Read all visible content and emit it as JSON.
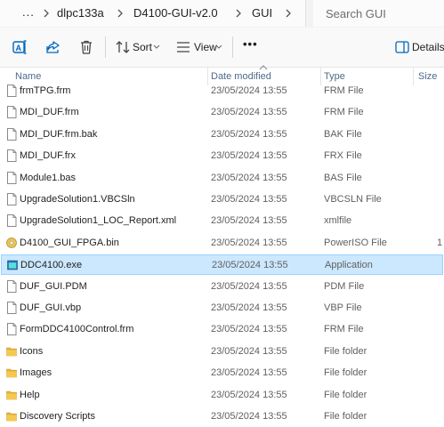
{
  "address_bar": {
    "overflow": "...",
    "crumbs": [
      "dlpc133a",
      "D4100-GUI-v2.0",
      "GUI"
    ],
    "search_placeholder": "Search GUI"
  },
  "toolbar": {
    "sort_label": "Sort",
    "view_label": "View",
    "more_label": "•••",
    "details_label": "Details"
  },
  "columns": {
    "name": "Name",
    "date": "Date modified",
    "type": "Type",
    "size": "Size"
  },
  "files": [
    {
      "name": "frmTPG.frm",
      "date": "23/05/2024 13:55",
      "type": "FRM File",
      "icon": "file-icon"
    },
    {
      "name": "MDI_DUF.frm",
      "date": "23/05/2024 13:55",
      "type": "FRM File",
      "icon": "file-icon"
    },
    {
      "name": "MDI_DUF.frm.bak",
      "date": "23/05/2024 13:55",
      "type": "BAK File",
      "icon": "file-icon"
    },
    {
      "name": "MDI_DUF.frx",
      "date": "23/05/2024 13:55",
      "type": "FRX File",
      "icon": "file-icon"
    },
    {
      "name": "Module1.bas",
      "date": "23/05/2024 13:55",
      "type": "BAS File",
      "icon": "file-icon"
    },
    {
      "name": "UpgradeSolution1.VBCSln",
      "date": "23/05/2024 13:55",
      "type": "VBCSLN File",
      "icon": "file-icon"
    },
    {
      "name": "UpgradeSolution1_LOC_Report.xml",
      "date": "23/05/2024 13:55",
      "type": "xmlfile",
      "icon": "file-icon"
    },
    {
      "name": "D4100_GUI_FPGA.bin",
      "date": "23/05/2024 13:55",
      "type": "PowerISO File",
      "size": "1",
      "icon": "disc-image-icon"
    },
    {
      "name": "DDC4100.exe",
      "date": "23/05/2024 13:55",
      "type": "Application",
      "icon": "application-icon",
      "selected": true
    },
    {
      "name": "DUF_GUI.PDM",
      "date": "23/05/2024 13:55",
      "type": "PDM File",
      "icon": "file-icon"
    },
    {
      "name": "DUF_GUI.vbp",
      "date": "23/05/2024 13:55",
      "type": "VBP File",
      "icon": "file-icon"
    },
    {
      "name": "FormDDC4100Control.frm",
      "date": "23/05/2024 13:55",
      "type": "FRM File",
      "icon": "file-icon"
    },
    {
      "name": "Icons",
      "date": "23/05/2024 13:55",
      "type": "File folder",
      "icon": "folder-icon"
    },
    {
      "name": "Images",
      "date": "23/05/2024 13:55",
      "type": "File folder",
      "icon": "folder-icon"
    },
    {
      "name": "Help",
      "date": "23/05/2024 13:55",
      "type": "File folder",
      "icon": "folder-icon"
    },
    {
      "name": "Discovery Scripts",
      "date": "23/05/2024 13:55",
      "type": "File folder",
      "icon": "folder-icon"
    }
  ],
  "colors": {
    "selection_bg": "#cce8ff",
    "selection_border": "#99d1ff",
    "folder": "#e8b53c",
    "accent": "#0067c0"
  }
}
